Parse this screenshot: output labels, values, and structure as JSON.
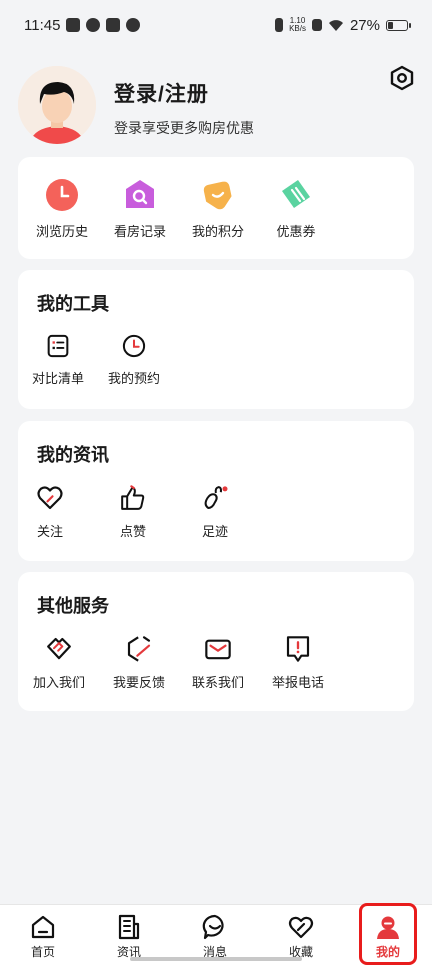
{
  "status_bar": {
    "time": "11:45",
    "net_speed_value": "1.10",
    "net_speed_unit": "KB/s",
    "battery": "27%"
  },
  "profile": {
    "title": "登录/注册",
    "subtitle": "登录享受更多购房优惠"
  },
  "quick_actions": [
    {
      "label": "浏览历史",
      "icon": "clock-icon"
    },
    {
      "label": "看房记录",
      "icon": "house-search-icon"
    },
    {
      "label": "我的积分",
      "icon": "points-tag-icon"
    },
    {
      "label": "优惠券",
      "icon": "ticket-icon"
    }
  ],
  "tools": {
    "title": "我的工具",
    "items": [
      {
        "label": "对比清单",
        "icon": "list-icon"
      },
      {
        "label": "我的预约",
        "icon": "clock-icon"
      }
    ]
  },
  "news": {
    "title": "我的资讯",
    "items": [
      {
        "label": "关注",
        "icon": "heart-icon"
      },
      {
        "label": "点赞",
        "icon": "thumbs-up-icon"
      },
      {
        "label": "足迹",
        "icon": "footprint-icon"
      }
    ]
  },
  "services": {
    "title": "其他服务",
    "items": [
      {
        "label": "加入我们",
        "icon": "handshake-icon"
      },
      {
        "label": "我要反馈",
        "icon": "feedback-icon"
      },
      {
        "label": "联系我们",
        "icon": "mail-icon"
      },
      {
        "label": "举报电话",
        "icon": "report-icon"
      }
    ]
  },
  "tabbar": {
    "items": [
      {
        "label": "首页",
        "icon": "home-icon"
      },
      {
        "label": "资讯",
        "icon": "news-icon"
      },
      {
        "label": "消息",
        "icon": "message-icon"
      },
      {
        "label": "收藏",
        "icon": "heart-icon"
      },
      {
        "label": "我的",
        "icon": "user-icon"
      }
    ],
    "active_index": 4
  },
  "colors": {
    "accent": "#e4393c",
    "background": "#f3f4f6"
  }
}
